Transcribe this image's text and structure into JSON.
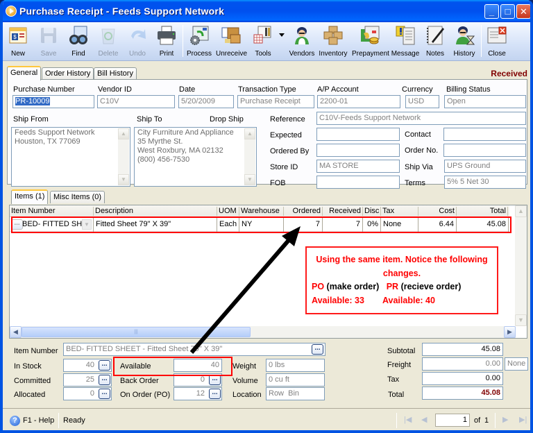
{
  "window": {
    "title": "Purchase Receipt - Feeds Support Network",
    "controls": {
      "minimize": "_",
      "maximize": "□",
      "close": "✕"
    }
  },
  "toolbar": {
    "buttons": [
      {
        "label": "New",
        "icon": "new-document-icon",
        "enabled": true
      },
      {
        "label": "Save",
        "icon": "floppy-disk-icon",
        "enabled": false
      },
      {
        "label": "Find",
        "icon": "binoculars-icon",
        "enabled": true
      },
      {
        "label": "Delete",
        "icon": "recycle-bin-icon",
        "enabled": false
      },
      {
        "label": "Undo",
        "icon": "undo-arrow-icon",
        "enabled": false
      },
      {
        "label": "Print",
        "icon": "printer-icon",
        "enabled": true
      },
      {
        "label": "Process",
        "icon": "gear-process-icon",
        "enabled": true
      },
      {
        "label": "Unreceive",
        "icon": "boxes-document-icon",
        "enabled": true
      },
      {
        "label": "Tools",
        "icon": "tools-icon",
        "enabled": true
      },
      {
        "label": "Vendors",
        "icon": "vendor-person-icon",
        "enabled": true
      },
      {
        "label": "Inventory",
        "icon": "boxes-icon",
        "enabled": true
      },
      {
        "label": "Prepayment",
        "icon": "prepayment-coins-icon",
        "enabled": true
      },
      {
        "label": "Message",
        "icon": "message-icon",
        "enabled": true
      },
      {
        "label": "Notes",
        "icon": "notepad-pen-icon",
        "enabled": true
      },
      {
        "label": "History",
        "icon": "history-hourglass-icon",
        "enabled": true
      },
      {
        "label": "Close",
        "icon": "close-window-icon",
        "enabled": true
      }
    ]
  },
  "tabs": [
    "General",
    "Order History",
    "Bill History"
  ],
  "status_label": "Received",
  "header": {
    "purchase_number": {
      "label": "Purchase Number",
      "value": "PR-10009"
    },
    "vendor_id": {
      "label": "Vendor ID",
      "value": "C10V"
    },
    "date": {
      "label": "Date",
      "value": "5/20/2009"
    },
    "transaction_type": {
      "label": "Transaction Type",
      "value": "Purchase Receipt"
    },
    "ap_account": {
      "label": "A/P Account",
      "value": "2200-01"
    },
    "currency": {
      "label": "Currency",
      "value": "USD"
    },
    "billing_status": {
      "label": "Billing Status",
      "value": "Open"
    }
  },
  "address": {
    "ship_from": {
      "label": "Ship From",
      "lines": [
        "Feeds Support Network",
        "Houston, TX 77069"
      ]
    },
    "ship_to": {
      "label": "Ship To",
      "lines": [
        "City Furniture And Appliance",
        "35 Myrthe St.",
        "West Roxbury, MA 02132",
        "(800) 456-7530"
      ]
    },
    "drop_ship_label": "Drop Ship"
  },
  "details": {
    "reference": {
      "label": "Reference",
      "value": "C10V-Feeds Support Network"
    },
    "expected": {
      "label": "Expected",
      "value": ""
    },
    "ordered_by": {
      "label": "Ordered By",
      "value": ""
    },
    "store_id": {
      "label": "Store ID",
      "value": "MA STORE"
    },
    "fob": {
      "label": "FOB",
      "value": ""
    },
    "contact": {
      "label": "Contact",
      "value": ""
    },
    "order_no": {
      "label": "Order No.",
      "value": ""
    },
    "ship_via": {
      "label": "Ship Via",
      "value": "UPS Ground"
    },
    "terms": {
      "label": "Terms",
      "value": "5% 5 Net 30"
    }
  },
  "item_tabs": [
    "Items (1)",
    "Misc Items (0)"
  ],
  "grid": {
    "columns": [
      "Item Number",
      "Description",
      "UOM",
      "Warehouse",
      "Ordered",
      "Received",
      "Disc",
      "Tax",
      "Cost",
      "Total"
    ],
    "rows": [
      {
        "item_number": "BED- FITTED SHE",
        "description": "Fitted Sheet 79\" X 39\"",
        "uom": "Each",
        "warehouse": "NY",
        "ordered": "7",
        "received": "7",
        "disc": "0%",
        "tax": "None",
        "cost": "6.44",
        "total": "45.08"
      }
    ]
  },
  "annotation": {
    "line1": "Using the same item. Notice the following",
    "line2": "changes.",
    "po_label": "PO",
    "po_desc": "(make order)",
    "pr_label": "PR",
    "pr_desc": "(recieve order)",
    "po_available": "Available: 33",
    "pr_available": "Available: 40"
  },
  "item_info": {
    "item_number": {
      "label": "Item Number",
      "value": "BED- FITTED SHEET - Fitted Sheet 79\" X 39\""
    },
    "in_stock": {
      "label": "In Stock",
      "value": "40"
    },
    "committed": {
      "label": "Committed",
      "value": "25"
    },
    "allocated": {
      "label": "Allocated",
      "value": "0"
    },
    "available": {
      "label": "Available",
      "value": "40"
    },
    "back_order": {
      "label": "Back Order",
      "value": "0"
    },
    "on_order": {
      "label": "On Order (PO)",
      "value": "12"
    },
    "weight": {
      "label": "Weight",
      "value": "0 lbs"
    },
    "volume": {
      "label": "Volume",
      "value": "0 cu ft"
    },
    "location": {
      "label": "Location",
      "value": "Row  Bin"
    }
  },
  "totals": {
    "subtotal": {
      "label": "Subtotal",
      "value": "45.08"
    },
    "freight": {
      "label": "Freight",
      "value": "0.00",
      "method": "None"
    },
    "tax": {
      "label": "Tax",
      "value": "0.00"
    },
    "total": {
      "label": "Total",
      "value": "45.08"
    }
  },
  "statusbar": {
    "help": "F1 - Help",
    "status": "Ready",
    "page": "1",
    "of_label": "of",
    "total_pages": "1"
  },
  "colors": {
    "accent_red": "#ff0000",
    "received_status": "#800000",
    "title_blue": "#0054e3"
  }
}
